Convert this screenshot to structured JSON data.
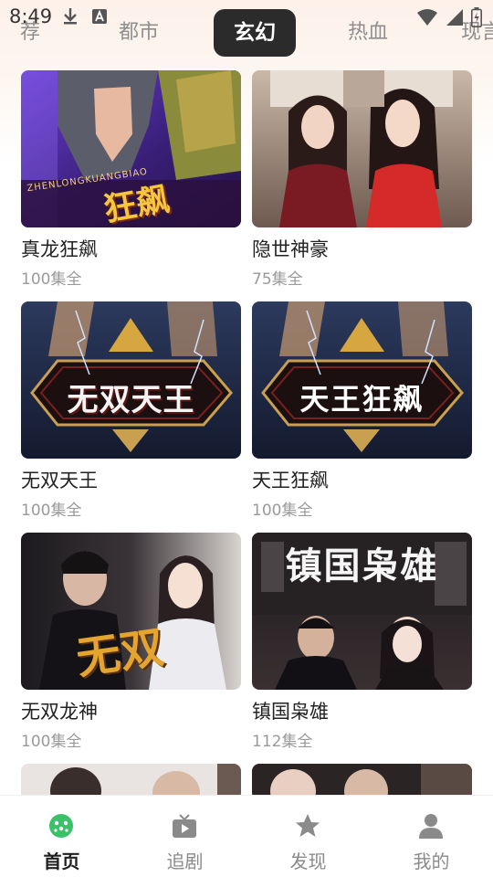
{
  "status_bar": {
    "time": "8:49",
    "icons": [
      "download-icon",
      "a-icon",
      "wifi-icon",
      "signal-icon",
      "battery-icon"
    ]
  },
  "tabs": [
    {
      "label": "荐",
      "active": false
    },
    {
      "label": "都市",
      "active": false
    },
    {
      "label": "玄幻",
      "active": true
    },
    {
      "label": "热血",
      "active": false
    },
    {
      "label": "现言",
      "active": false
    }
  ],
  "dramas": [
    {
      "title": "真龙狂飙",
      "episodes": "100集全"
    },
    {
      "title": "隐世神豪",
      "episodes": "75集全"
    },
    {
      "title": "无双天王",
      "episodes": "100集全"
    },
    {
      "title": "天王狂飙",
      "episodes": "100集全"
    },
    {
      "title": "无双龙神",
      "episodes": "100集全"
    },
    {
      "title": "镇国枭雄",
      "episodes": "112集全"
    }
  ],
  "covers": {
    "c1_text": "ZHENLONGKUANGBIAO",
    "c1_big": "狂飙",
    "c3_text": "无双天王",
    "c4_text": "天王狂飙",
    "c5_text": "无双",
    "c6_text": "镇国枭雄"
  },
  "bottom_nav": [
    {
      "label": "首页",
      "icon": "home-icon",
      "active": true
    },
    {
      "label": "追剧",
      "icon": "tv-icon",
      "active": false
    },
    {
      "label": "发现",
      "icon": "star-icon",
      "active": false
    },
    {
      "label": "我的",
      "icon": "user-icon",
      "active": false
    }
  ],
  "colors": {
    "accent": "#3cc06a",
    "active_tab_bg": "#2b2b2b",
    "inactive_text": "#8e8e8e"
  }
}
